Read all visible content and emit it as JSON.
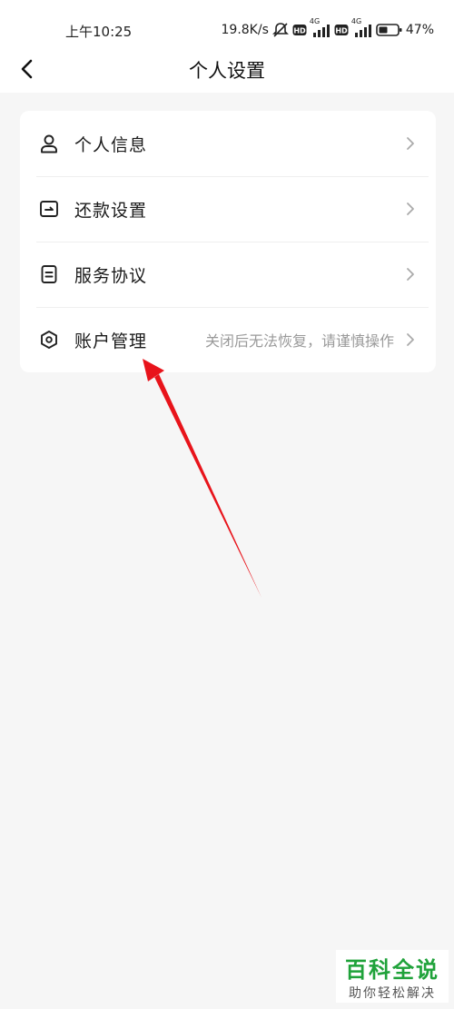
{
  "status_bar": {
    "time": "上午10:25",
    "speed": "19.8K/s",
    "network_1": "4G",
    "network_2": "4G",
    "battery": "47%"
  },
  "header": {
    "title": "个人设置"
  },
  "menu": {
    "items": [
      {
        "label": "个人信息",
        "icon": "user-icon"
      },
      {
        "label": "还款设置",
        "icon": "repayment-card-icon"
      },
      {
        "label": "服务协议",
        "icon": "document-icon"
      },
      {
        "label": "账户管理",
        "icon": "hexagon-settings-icon",
        "hint": "关闭后无法恢复，请谨慎操作"
      }
    ]
  },
  "annotation": {
    "arrow_color": "#e8141b"
  },
  "watermark": {
    "title": "百科全说",
    "subtitle": "助你轻松解决"
  }
}
